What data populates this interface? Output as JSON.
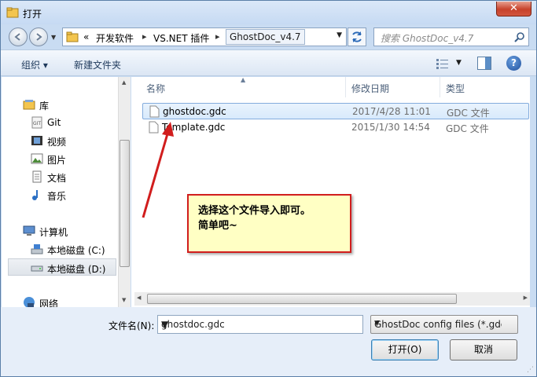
{
  "window": {
    "title": "打开",
    "close_label": "✕"
  },
  "address": {
    "prefix": "«",
    "crumbs": [
      "开发软件",
      "VS.NET 插件"
    ],
    "current": "GhostDoc_v4.7",
    "search_placeholder": "搜索 GhostDoc_v4.7"
  },
  "toolbar": {
    "organize": "组织 ▾",
    "new_folder": "新建文件夹",
    "help": "?"
  },
  "nav": {
    "items": [
      {
        "label": "库",
        "icon": "library-icon"
      },
      {
        "label": "Git",
        "icon": "git-folder-icon"
      },
      {
        "label": "视频",
        "icon": "video-icon"
      },
      {
        "label": "图片",
        "icon": "picture-icon"
      },
      {
        "label": "文档",
        "icon": "document-icon"
      },
      {
        "label": "音乐",
        "icon": "music-icon"
      },
      {
        "label": "计算机",
        "icon": "computer-icon"
      },
      {
        "label": "本地磁盘 (C:)",
        "icon": "system-drive-icon"
      },
      {
        "label": "本地磁盘 (D:)",
        "icon": "drive-icon"
      },
      {
        "label": "网络",
        "icon": "network-icon"
      }
    ]
  },
  "files": {
    "columns": {
      "name": "名称",
      "date": "修改日期",
      "type": "类型"
    },
    "rows": [
      {
        "name": "ghostdoc.gdc",
        "date": "2017/4/28 11:01",
        "type": "GDC 文件",
        "selected": true
      },
      {
        "name": "Template.gdc",
        "date": "2015/1/30 14:54",
        "type": "GDC 文件",
        "selected": false
      }
    ]
  },
  "annotation": {
    "line1": "选择这个文件导入即可。",
    "line2": "简单吧~",
    "color": "#d11d1d"
  },
  "bottom": {
    "filename_label": "文件名(N):",
    "filename_value": "ghostdoc.gdc",
    "filter": "GhostDoc config files (*.gdc)",
    "open_button": "打开(O)",
    "cancel_button": "取消"
  }
}
